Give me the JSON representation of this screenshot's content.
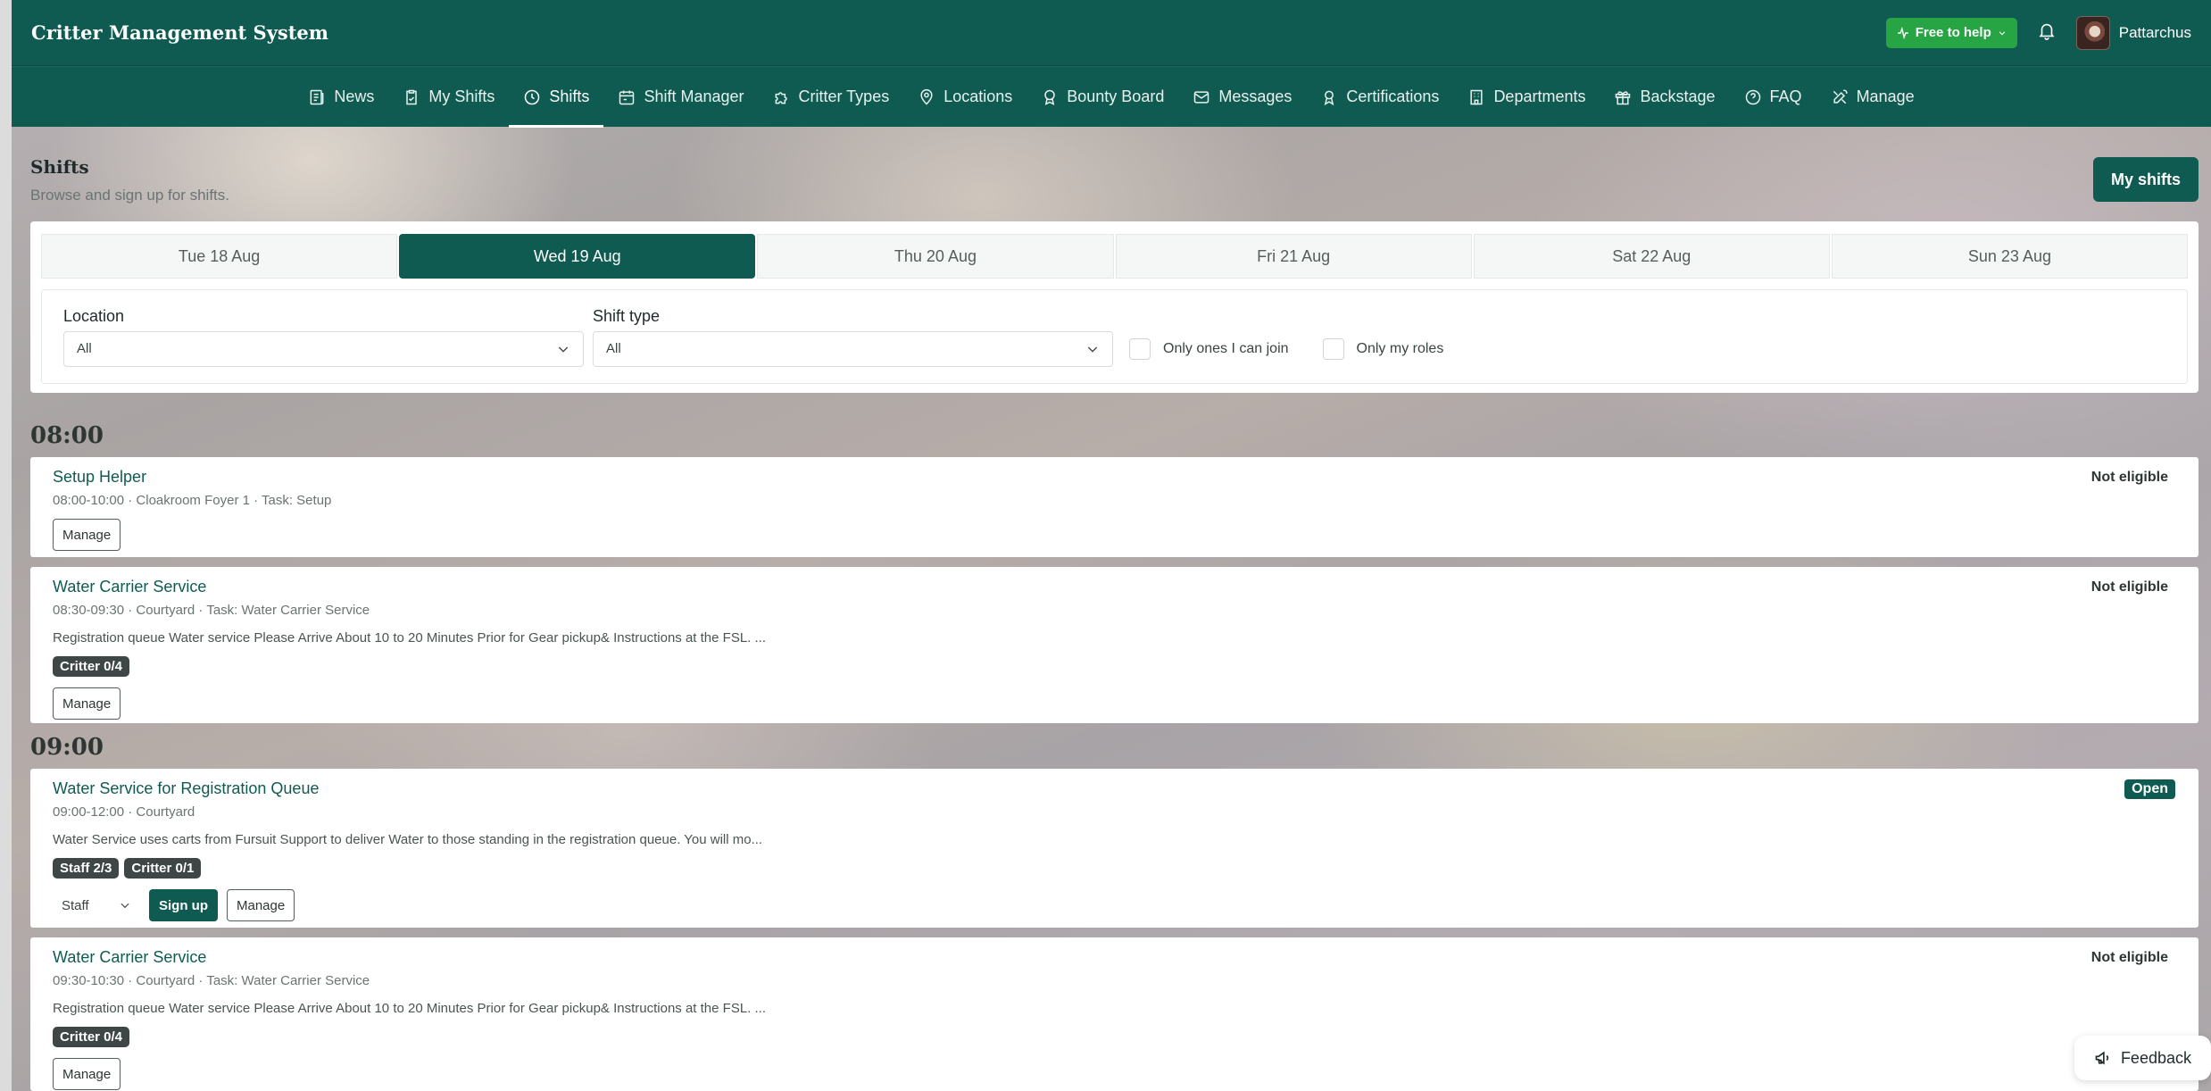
{
  "app": {
    "title": "Critter Management System",
    "help_status": "Free to help",
    "user_name": "Pattarchus"
  },
  "nav": [
    {
      "label": "News",
      "icon": "newspaper-icon"
    },
    {
      "label": "My Shifts",
      "icon": "clipboard-icon"
    },
    {
      "label": "Shifts",
      "icon": "clock-icon",
      "active": true
    },
    {
      "label": "Shift Manager",
      "icon": "calendar-icon"
    },
    {
      "label": "Critter Types",
      "icon": "puzzle-icon"
    },
    {
      "label": "Locations",
      "icon": "map-pin-icon"
    },
    {
      "label": "Bounty Board",
      "icon": "award-icon"
    },
    {
      "label": "Messages",
      "icon": "mail-icon"
    },
    {
      "label": "Certifications",
      "icon": "certificate-icon"
    },
    {
      "label": "Departments",
      "icon": "building-icon"
    },
    {
      "label": "Backstage",
      "icon": "gift-icon"
    },
    {
      "label": "FAQ",
      "icon": "help-circle-icon"
    },
    {
      "label": "Manage",
      "icon": "tools-icon"
    }
  ],
  "page": {
    "title": "Shifts",
    "subtitle": "Browse and sign up for shifts.",
    "my_shifts_button": "My shifts"
  },
  "days": [
    "Tue 18 Aug",
    "Wed 19 Aug",
    "Thu 20 Aug",
    "Fri 21 Aug",
    "Sat 22 Aug",
    "Sun 23 Aug"
  ],
  "selected_day_index": 1,
  "filters": {
    "location_label": "Location",
    "location_value": "All",
    "shift_type_label": "Shift type",
    "shift_type_value": "All",
    "only_joinable_label": "Only ones I can join",
    "only_my_roles_label": "Only my roles"
  },
  "time_groups": [
    "08:00",
    "09:00"
  ],
  "shifts": [
    {
      "title": "Setup Helper",
      "meta": "08:00-10:00 · Cloakroom Foyer 1 · Task: Setup",
      "status": "Not eligible",
      "manage": "Manage"
    },
    {
      "title": "Water Carrier Service",
      "meta": "08:30-09:30 · Courtyard · Task: Water Carrier Service",
      "description": "Registration queue Water service Please Arrive About 10 to 20 Minutes Prior for Gear pickup& Instructions at the FSL. ...",
      "tags": [
        "Critter 0/4"
      ],
      "status": "Not eligible",
      "manage": "Manage"
    },
    {
      "title": "Water Service for Registration Queue",
      "meta": "09:00-12:00 · Courtyard",
      "description": "Water Service uses carts from Fursuit Support to deliver Water to those standing in the registration queue. You will mo...",
      "tags": [
        "Staff 2/3",
        "Critter 0/1"
      ],
      "status": "Open",
      "role_select": "Staff",
      "signup": "Sign up",
      "manage": "Manage"
    },
    {
      "title": "Water Carrier Service",
      "meta": "09:30-10:30 · Courtyard · Task: Water Carrier Service",
      "description": "Registration queue Water service Please Arrive About 10 to 20 Minutes Prior for Gear pickup& Instructions at the FSL. ...",
      "tags": [
        "Critter 0/4"
      ],
      "status": "Not eligible",
      "manage": "Manage"
    }
  ],
  "feedback_label": "Feedback",
  "colors": {
    "brand": "#0f5b52",
    "help_green": "#27a545",
    "tag_dark": "#3e4746"
  }
}
